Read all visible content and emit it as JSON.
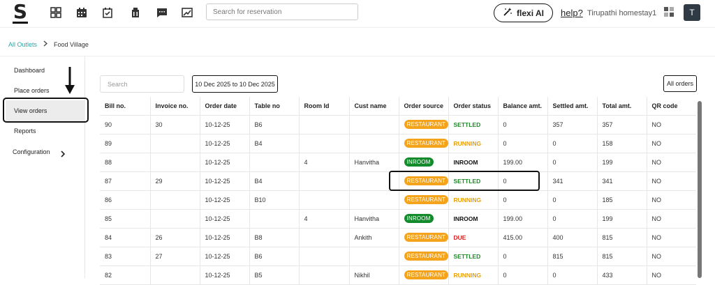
{
  "topbar": {
    "logo": "S",
    "icons": [
      "dashboard-icon",
      "calendar-icon",
      "calendar-check-icon",
      "housekeeping-icon",
      "chat-icon",
      "report-icon"
    ],
    "search_placeholder": "Search for reservation",
    "flexi_label": "flexi AI",
    "help_label": "help?",
    "property_name": "Tirupathi homestay1",
    "avatar_initial": "T"
  },
  "breadcrumb": {
    "root": "All Outlets",
    "current": "Food Village"
  },
  "sidebar": {
    "items": [
      {
        "label": "Dashboard"
      },
      {
        "label": "Place orders"
      },
      {
        "label": "View orders"
      },
      {
        "label": "Reports"
      },
      {
        "label": "Configuration"
      }
    ],
    "active": "View orders"
  },
  "filters": {
    "search_placeholder": "Search",
    "date_range": "10 Dec 2025 to 10 Dec 2025",
    "orders_filter": "All orders"
  },
  "colors": {
    "restaurant_badge": "#f5a31a",
    "inroom_badge": "#138a2c",
    "settled": "#1f8a2a",
    "running": "#e8a000",
    "inroom": "#111111",
    "due": "#d32020",
    "accent": "#2aa6a6"
  },
  "table": {
    "columns": [
      "Bill no.",
      "Invoice no.",
      "Order date",
      "Table no",
      "Room Id",
      "Cust name",
      "Order source",
      "Order status",
      "Balance amt.",
      "Settled amt.",
      "Total amt.",
      "QR code"
    ],
    "rows": [
      {
        "bill": "90",
        "invoice": "30",
        "date": "10-12-25",
        "table": "B6",
        "room": "",
        "cust": "",
        "source": "RESTAURANT",
        "status": "SETTLED",
        "balance": "0",
        "settled": "357",
        "total": "357",
        "qr": "NO"
      },
      {
        "bill": "89",
        "invoice": "",
        "date": "10-12-25",
        "table": "B4",
        "room": "",
        "cust": "",
        "source": "RESTAURANT",
        "status": "RUNNING",
        "balance": "0",
        "settled": "0",
        "total": "158",
        "qr": "NO"
      },
      {
        "bill": "88",
        "invoice": "",
        "date": "10-12-25",
        "table": "",
        "room": "4",
        "cust": "Hanvitha",
        "source": "INROOM",
        "status": "INROOM",
        "balance": "199.00",
        "settled": "0",
        "total": "199",
        "qr": "NO"
      },
      {
        "bill": "87",
        "invoice": "29",
        "date": "10-12-25",
        "table": "B4",
        "room": "",
        "cust": "",
        "source": "RESTAURANT",
        "status": "SETTLED",
        "balance": "0",
        "settled": "341",
        "total": "341",
        "qr": "NO"
      },
      {
        "bill": "86",
        "invoice": "",
        "date": "10-12-25",
        "table": "B10",
        "room": "",
        "cust": "",
        "source": "RESTAURANT",
        "status": "RUNNING",
        "balance": "0",
        "settled": "0",
        "total": "185",
        "qr": "NO"
      },
      {
        "bill": "85",
        "invoice": "",
        "date": "10-12-25",
        "table": "",
        "room": "4",
        "cust": "Hanvitha",
        "source": "INROOM",
        "status": "INROOM",
        "balance": "199.00",
        "settled": "0",
        "total": "199",
        "qr": "NO"
      },
      {
        "bill": "84",
        "invoice": "26",
        "date": "10-12-25",
        "table": "B8",
        "room": "",
        "cust": "Ankith",
        "source": "RESTAURANT",
        "status": "DUE",
        "balance": "415.00",
        "settled": "400",
        "total": "815",
        "qr": "NO"
      },
      {
        "bill": "83",
        "invoice": "27",
        "date": "10-12-25",
        "table": "B6",
        "room": "",
        "cust": "",
        "source": "RESTAURANT",
        "status": "SETTLED",
        "balance": "0",
        "settled": "815",
        "total": "815",
        "qr": "NO"
      },
      {
        "bill": "82",
        "invoice": "",
        "date": "10-12-25",
        "table": "B5",
        "room": "",
        "cust": "Nikhil",
        "source": "RESTAURANT",
        "status": "RUNNING",
        "balance": "0",
        "settled": "0",
        "total": "433",
        "qr": "NO"
      }
    ]
  }
}
